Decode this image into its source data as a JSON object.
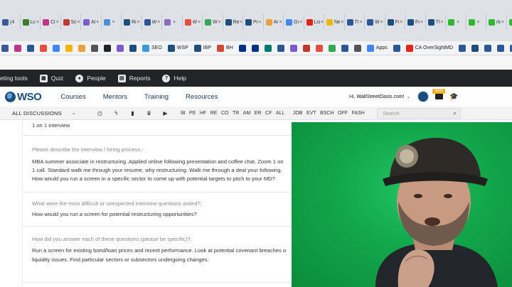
{
  "browser": {
    "tabs": [
      {
        "label": "(4",
        "color": "#3b5998",
        "close": false
      },
      {
        "label": "Lc",
        "color": "#3a7d2c",
        "close": true
      },
      {
        "label": "Cl",
        "color": "#c13584",
        "close": true
      },
      {
        "label": "Sc",
        "color": "#c0392b",
        "close": true
      },
      {
        "label": "Al",
        "color": "#7b5cc8",
        "close": true
      },
      {
        "label": "",
        "color": "#4a90d9",
        "close": true
      },
      {
        "label": "Ri",
        "color": "#1d4e7c",
        "close": true
      },
      {
        "label": "W",
        "color": "#2b5797",
        "close": true
      },
      {
        "label": "",
        "color": "#8a6bbf",
        "close": true
      },
      {
        "label": "W",
        "color": "#e94b3c",
        "close": true
      },
      {
        "label": "W",
        "color": "#34a853",
        "close": true
      },
      {
        "label": "Re",
        "color": "#1d4e7c",
        "close": true
      },
      {
        "label": "Pi",
        "color": "#1d4e7c",
        "close": true
      },
      {
        "label": "Ar",
        "color": "#e8a33d",
        "close": true
      },
      {
        "label": "Gi",
        "color": "#4285f4",
        "close": true
      },
      {
        "label": "Lis",
        "color": "#e62117",
        "close": true
      },
      {
        "label": "Ne",
        "color": "#f4b400",
        "close": true
      },
      {
        "label": "Tl",
        "color": "#2b5797",
        "close": true
      },
      {
        "label": "W",
        "color": "#2b5797",
        "close": true
      },
      {
        "label": "Fi",
        "color": "#1d4e7c",
        "close": true
      },
      {
        "label": "Fi",
        "color": "#1d4e7c",
        "close": true
      },
      {
        "label": "Tl",
        "color": "#1d4e7c",
        "close": true
      },
      {
        "label": "",
        "color": "#2eb82e",
        "close": true
      },
      {
        "label": "",
        "color": "#2eb82e",
        "close": true
      },
      {
        "label": "rk",
        "color": "#2eb82e",
        "close": true
      },
      {
        "label": "rk",
        "color": "#2eb82e",
        "close": true
      },
      {
        "label": "Tl",
        "color": "#1d4e7c",
        "close": true
      },
      {
        "label": "Tl",
        "color": "#1d4e7c",
        "close": true
      }
    ]
  },
  "bookmarks": [
    {
      "label": "",
      "color": "#3b5998"
    },
    {
      "label": "",
      "color": "#c13584"
    },
    {
      "label": "",
      "color": "#2b5797"
    },
    {
      "label": "",
      "color": "#e94b3c"
    },
    {
      "label": "",
      "color": "#4285f4"
    },
    {
      "label": "",
      "color": "#f4b400"
    },
    {
      "label": "",
      "color": "#e8a33d"
    },
    {
      "label": "",
      "color": "#555555"
    },
    {
      "label": "",
      "color": "#222222"
    },
    {
      "label": "",
      "color": "#7b5cc8"
    },
    {
      "label": "",
      "color": "#1d4e7c"
    },
    {
      "label": "SEO",
      "color": "#3a9ad9"
    },
    {
      "label": "WSP",
      "color": "#1d4e7c"
    },
    {
      "label": "IBP",
      "color": "#1d4e7c"
    },
    {
      "label": "BH",
      "color": "#d14836"
    },
    {
      "label": "",
      "color": "#003087"
    },
    {
      "label": "",
      "color": "#003087"
    },
    {
      "label": "",
      "color": "#00796b"
    },
    {
      "label": "",
      "color": "#2b5797"
    },
    {
      "label": "",
      "color": "#7b5cc8"
    },
    {
      "label": "",
      "color": "#c0392b"
    },
    {
      "label": "",
      "color": "#e94b3c"
    },
    {
      "label": "",
      "color": "#34a853"
    },
    {
      "label": "",
      "color": "#2b5797"
    },
    {
      "label": "",
      "color": "#555555"
    },
    {
      "label": "Apps",
      "color": "#4285f4"
    },
    {
      "label": "",
      "color": "#2b5797"
    },
    {
      "label": "CA OverSightMD",
      "color": "#e62117"
    },
    {
      "label": "",
      "color": "#2b5797"
    },
    {
      "label": "",
      "color": "#1d4e7c"
    },
    {
      "label": "",
      "color": "#2b5797"
    },
    {
      "label": "",
      "color": "#2b5797"
    },
    {
      "label": "",
      "color": "#3b5998"
    },
    {
      "label": "",
      "color": "#2b5797"
    },
    {
      "label": "",
      "color": "#1d4e7c"
    }
  ],
  "toolbar": {
    "items": [
      {
        "label": "eting tools",
        "icon": ""
      },
      {
        "label": "Quiz",
        "icon": "▦"
      },
      {
        "label": "People",
        "icon": "●"
      },
      {
        "label": "Reports",
        "icon": "▤"
      },
      {
        "label": "Help",
        "icon": "?"
      }
    ]
  },
  "nav": {
    "logo_text": "WSO",
    "links": [
      "Courses",
      "Mentors",
      "Training",
      "Resources"
    ],
    "greeting": "Hi,",
    "username": "WallStreetOasis.com!",
    "badge": "5000",
    "colors": {
      "brand": "#1d4e7c",
      "badge": "#f2b01e"
    }
  },
  "filter": {
    "dropdown_label": "ALL DISCUSSIONS",
    "tags": [
      "IB",
      "PE",
      "HF",
      "RE",
      "CO",
      "TR",
      "AM",
      "ER",
      "CF",
      "ALL",
      "JOB",
      "EVT",
      "BSCH",
      "OFF",
      "FASH"
    ],
    "search_placeholder": "Search"
  },
  "content": {
    "top_line": "1 on 1 interview",
    "q1": "Please describe the interview / hiring process.:",
    "a1": [
      "MBA summer associate in restructuring. Applied online following presentation and coffee chat. Zoom 1 on",
      "1 call. Standard walk me through your resume, why restructuring. Walk me through a deal your following.",
      "How would you run a screen in a specific sector to come up with potential targets to pitch to your MD?"
    ],
    "q2": "What were the most difficult or unexpected interview questions asked?:",
    "a2": "How would you run a screen for potential restructuring opportunities?",
    "q3": "How did you answer each of these questions (please be specific)?:",
    "a3": [
      "Run a screen for existing bond/loan prices and recent performance. Look at potential covenant breaches o",
      "liquidity issues. Find particular sectors or subsectors undergoing changes."
    ]
  }
}
